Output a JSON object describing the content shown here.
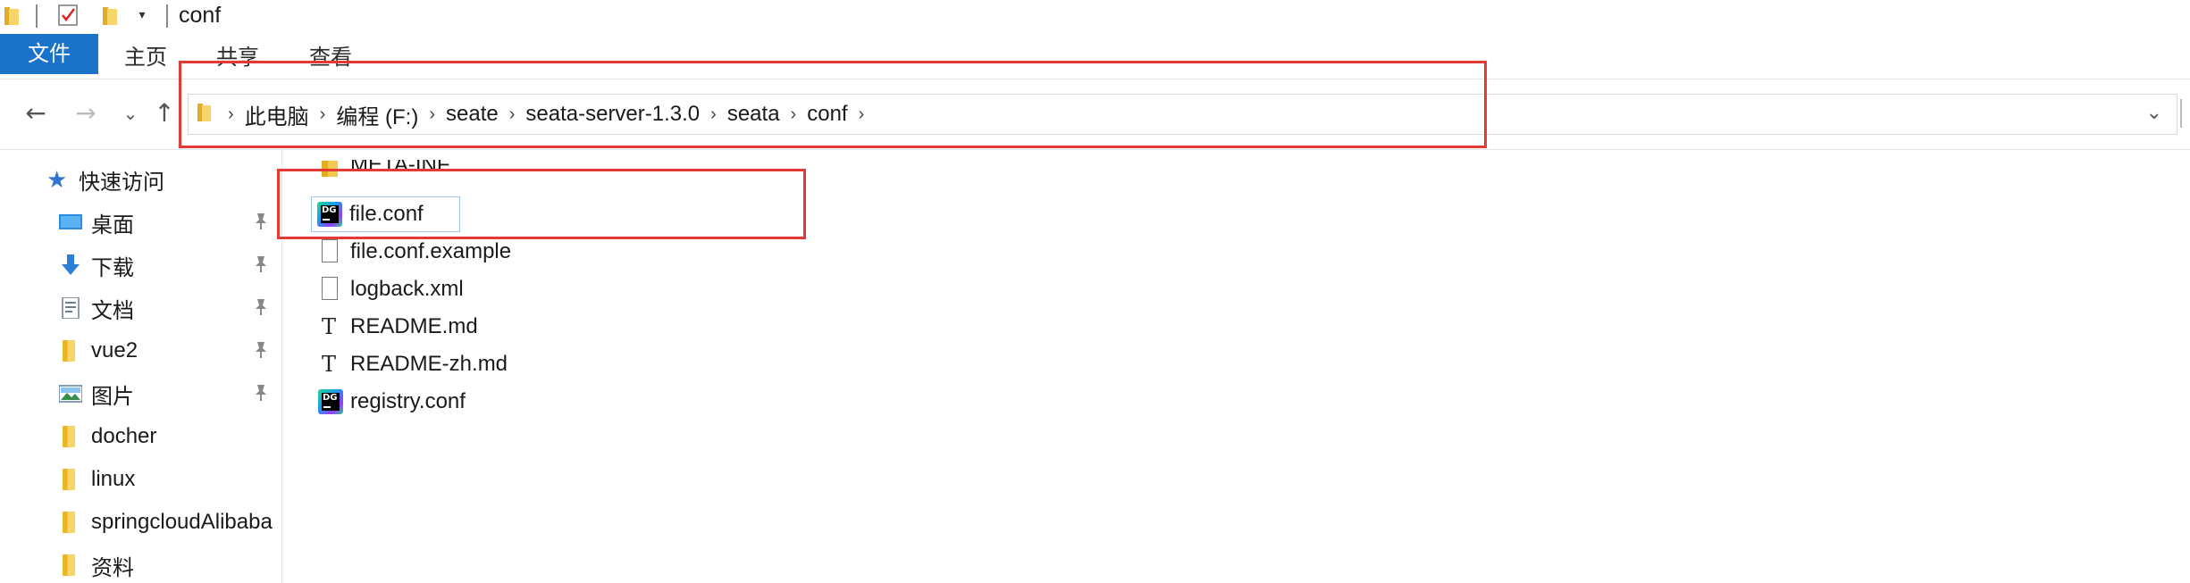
{
  "window": {
    "title": "conf"
  },
  "quick_access_toolbar": {
    "icons": [
      "folder-icon",
      "properties-checklist-icon",
      "new-folder-icon",
      "customize-dropdown-icon"
    ],
    "dropdown_glyph": "▾"
  },
  "ribbon": {
    "tabs": [
      {
        "label": "文件",
        "active": true
      },
      {
        "label": "主页",
        "active": false
      },
      {
        "label": "共享",
        "active": false
      },
      {
        "label": "查看",
        "active": false
      }
    ],
    "accent_color": "#1a73c8"
  },
  "navigation": {
    "back_glyph": "←",
    "forward_glyph": "→",
    "recent_glyph": "⌄",
    "up_glyph": "↑"
  },
  "address_bar": {
    "breadcrumbs": [
      "此电脑",
      "编程 (F:)",
      "seate",
      "seata-server-1.3.0",
      "seata",
      "conf"
    ],
    "separator": "›",
    "dropdown_glyph": "⌄"
  },
  "nav_pane": {
    "items": [
      {
        "label": "快速访问",
        "icon": "star-icon",
        "pinned": false
      },
      {
        "label": "桌面",
        "icon": "desktop-icon",
        "pinned": true
      },
      {
        "label": "下载",
        "icon": "download-icon",
        "pinned": true
      },
      {
        "label": "文档",
        "icon": "document-icon",
        "pinned": true
      },
      {
        "label": "vue2",
        "icon": "folder-icon",
        "pinned": true
      },
      {
        "label": "图片",
        "icon": "pictures-icon",
        "pinned": true
      },
      {
        "label": "docher",
        "icon": "folder-icon",
        "pinned": false
      },
      {
        "label": "linux",
        "icon": "folder-icon",
        "pinned": false
      },
      {
        "label": "springcloudAlibaba",
        "icon": "folder-icon",
        "pinned": false
      },
      {
        "label": "资料",
        "icon": "folder-icon",
        "pinned": false
      }
    ],
    "pin_glyph": "📌"
  },
  "files": [
    {
      "name": "META-INF",
      "icon": "folder-icon",
      "selected": false
    },
    {
      "name": "file.conf",
      "icon": "datagrip-icon",
      "selected": true
    },
    {
      "name": "file.conf.example",
      "icon": "file-icon",
      "selected": false
    },
    {
      "name": "logback.xml",
      "icon": "file-icon",
      "selected": false
    },
    {
      "name": "README.md",
      "icon": "text-file-icon",
      "selected": false
    },
    {
      "name": "README-zh.md",
      "icon": "text-file-icon",
      "selected": false
    },
    {
      "name": "registry.conf",
      "icon": "datagrip-icon",
      "selected": false
    }
  ],
  "annotations": {
    "highlight_color": "#e53935",
    "boxes": [
      "address-bar-highlight",
      "file-conf-highlight"
    ]
  },
  "icon_labels": {
    "datagrip_text": "DG",
    "text_file_glyph": "T"
  }
}
